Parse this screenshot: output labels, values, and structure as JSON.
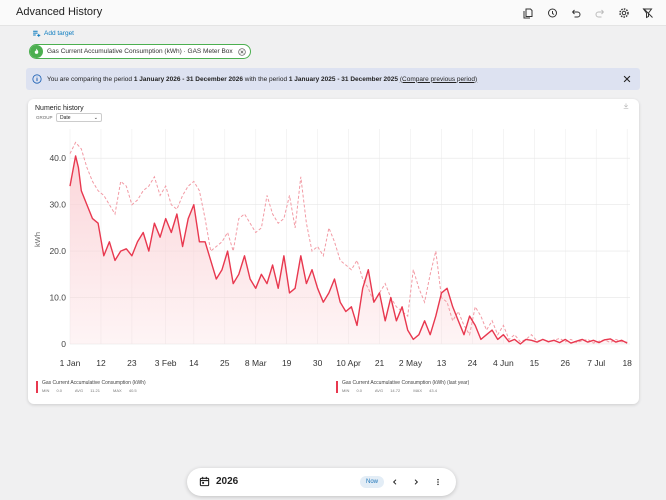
{
  "app": {
    "title": "Advanced History"
  },
  "toolbar_icons": [
    "file-copy-icon",
    "history-icon",
    "undo-icon",
    "redo-icon",
    "settings-icon",
    "filter-off-icon"
  ],
  "add_target_label": "Add target",
  "target_chip": {
    "label": "Gas Current Accumulative Consumption (kWh) · GAS Meter Box",
    "icon": "fire-icon",
    "color": "#4caf50"
  },
  "info": {
    "prefix": "You are comparing the period ",
    "period_current": "1 January 2026 - 31 December 2026",
    "middle": " with the period ",
    "period_previous": "1 January 2025 - 31 December 2025",
    "link": "(Compare previous period)"
  },
  "card": {
    "title": "Numeric history",
    "group_label": "GROUP",
    "group_value": "Date"
  },
  "chart_data": {
    "type": "area",
    "ylabel": "kWh",
    "ylim": [
      0,
      45
    ],
    "yticks": [
      0,
      10.0,
      20.0,
      30.0,
      40.0
    ],
    "ytick_labels": [
      "0",
      "10.0",
      "20.0",
      "30.0",
      "40.0"
    ],
    "xlim": [
      1,
      200
    ],
    "xticks": [
      1,
      12,
      23,
      35,
      45,
      56,
      67,
      78,
      89,
      100,
      111,
      122,
      133,
      144,
      155,
      166,
      177,
      188,
      199
    ],
    "xtick_labels": [
      "1 Jan",
      "12",
      "23",
      "3 Feb",
      "14",
      "25",
      "8 Mar",
      "19",
      "30",
      "10 Apr",
      "21",
      "2 May",
      "13",
      "24",
      "4 Jun",
      "15",
      "26",
      "7 Jul",
      "18"
    ],
    "colors": {
      "current": "#e8384f",
      "previous": "#f29aa4",
      "fill": "#fbd4d8"
    },
    "series": [
      {
        "name": "Gas Current Accumulative Consumption (kWh)",
        "x": [
          1,
          3,
          4,
          5,
          7,
          9,
          11,
          13,
          15,
          17,
          19,
          21,
          23,
          25,
          27,
          29,
          31,
          33,
          35,
          37,
          39,
          41,
          43,
          45,
          47,
          49,
          51,
          53,
          55,
          57,
          59,
          61,
          63,
          65,
          67,
          69,
          71,
          73,
          75,
          77,
          79,
          81,
          83,
          85,
          87,
          89,
          91,
          93,
          95,
          97,
          99,
          101,
          103,
          105,
          107,
          109,
          111,
          113,
          115,
          117,
          119,
          121,
          123,
          125,
          127,
          129,
          131,
          133,
          135,
          137,
          139,
          141,
          143,
          145,
          147,
          149,
          151,
          153,
          155,
          157,
          159,
          161,
          163,
          165,
          167,
          169,
          171,
          173,
          175,
          177,
          179,
          181,
          183,
          185,
          187,
          189,
          191,
          193,
          195,
          197,
          199
        ],
        "values": [
          34,
          40.5,
          38,
          33,
          30,
          27,
          26,
          19,
          22,
          18,
          20,
          20.5,
          19,
          22,
          24,
          20,
          26,
          23,
          27,
          24,
          28,
          21,
          27,
          30,
          22,
          22,
          18,
          14,
          16,
          20,
          13,
          15,
          19,
          14,
          12,
          15,
          13,
          17,
          12,
          19,
          11,
          12,
          19,
          13,
          16,
          12,
          9,
          11,
          14,
          9,
          7,
          8,
          4,
          12,
          16,
          9,
          11,
          5,
          10,
          5,
          8,
          3,
          1,
          2,
          5,
          2,
          6,
          11,
          12,
          8,
          5,
          2,
          6,
          4,
          1,
          2,
          3,
          1,
          2,
          0.5,
          1,
          0,
          1,
          0.8,
          0.4,
          1,
          0.5,
          0.8,
          0.3,
          1,
          0.2,
          0.6,
          1,
          0.4,
          0.8,
          0.3,
          0.9,
          1.1,
          0.4,
          0.8,
          0.2
        ]
      },
      {
        "name": "Gas Current Accumulative Consumption (kWh) (last year)",
        "x": [
          1,
          3,
          5,
          7,
          9,
          11,
          13,
          15,
          17,
          19,
          21,
          23,
          25,
          27,
          29,
          31,
          33,
          35,
          37,
          39,
          41,
          43,
          45,
          47,
          49,
          51,
          53,
          55,
          57,
          59,
          61,
          63,
          65,
          67,
          69,
          71,
          73,
          75,
          77,
          79,
          81,
          83,
          85,
          87,
          89,
          91,
          93,
          95,
          97,
          99,
          101,
          103,
          105,
          107,
          109,
          111,
          113,
          115,
          117,
          119,
          121,
          123,
          125,
          127,
          129,
          131,
          133,
          135,
          137,
          139,
          141,
          143,
          145,
          147,
          149,
          151,
          153,
          155,
          157,
          159,
          161,
          163,
          165,
          167,
          169,
          171,
          173,
          175,
          177,
          179,
          181,
          183,
          185,
          187,
          189,
          191,
          193,
          195,
          197,
          199
        ],
        "values": [
          41,
          43.4,
          42,
          38,
          35,
          33,
          32,
          30,
          28,
          35,
          34,
          30,
          31,
          33,
          34,
          36,
          32,
          34,
          30,
          29,
          32,
          34,
          35,
          33,
          27,
          20,
          21,
          22,
          24,
          20,
          27,
          28,
          26,
          24,
          25,
          32,
          28,
          26,
          27,
          32,
          25,
          36,
          26,
          20,
          21,
          19,
          25,
          22,
          18,
          17,
          16,
          18,
          14,
          12,
          9,
          11,
          13,
          10,
          8,
          7,
          6,
          16,
          12,
          9,
          15,
          20,
          10,
          9,
          5,
          7,
          4,
          2,
          8,
          6,
          3,
          5,
          2,
          4,
          1,
          2,
          0.5,
          1,
          2,
          0.6,
          1,
          0.4,
          0.8,
          1.2,
          0.5,
          1,
          0.3,
          0.7,
          1,
          0.2,
          0.6,
          0.9,
          0.3,
          1,
          0.5,
          0.4
        ]
      }
    ]
  },
  "legend": [
    {
      "name": "Gas Current Accumulative Consumption (kWh)",
      "min_label": "MIN",
      "min": "0.0",
      "avg_label": "AVG",
      "avg": "11.21",
      "max_label": "MAX",
      "max": "40.5",
      "color": "#e8384f"
    },
    {
      "name": "Gas Current Accumulative Consumption (kWh) (last year)",
      "min_label": "MIN",
      "min": "0.0",
      "avg_label": "AVG",
      "avg": "14.72",
      "max_label": "MAX",
      "max": "43.4",
      "color": "#e8384f"
    }
  ],
  "datebar": {
    "year": "2026",
    "now_label": "Now"
  }
}
